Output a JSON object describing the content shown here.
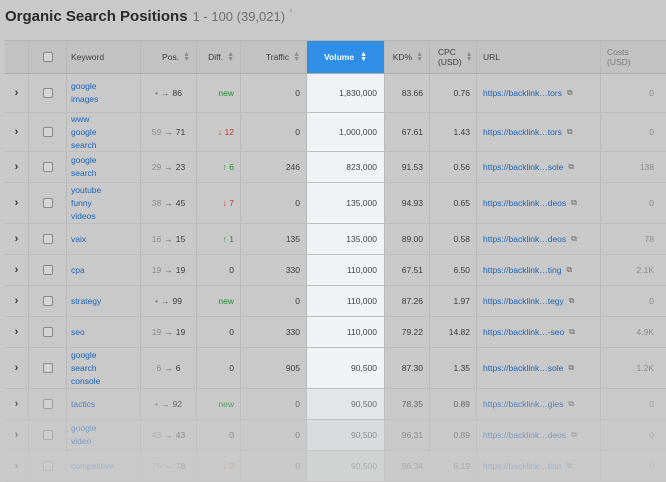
{
  "header": {
    "title": "Organic Search Positions",
    "range": "1 - 100 (39,021)",
    "info": "ⁱ"
  },
  "columns": {
    "keyword": "Keyword",
    "pos": "Pos.",
    "diff": "Diff.",
    "traffic": "Traffic",
    "volume": "Volume",
    "kd": "KD%",
    "cpc_1": "CPC",
    "cpc_2": "(USD)",
    "url": "URL",
    "costs_1": "Costs",
    "costs_2": "(USD)"
  },
  "rows": [
    {
      "keyword": "google images",
      "kw_lines": [
        "google",
        "images"
      ],
      "pos_from": "•",
      "pos_to": "86",
      "diff": "new",
      "diff_type": "new",
      "traffic": "0",
      "volume": "1,830,000",
      "kd": "83.66",
      "cpc": "0.76",
      "url": "https://backlink…tors",
      "costs": "0"
    },
    {
      "keyword": "www google search",
      "kw_lines": [
        "www",
        "google",
        "search"
      ],
      "pos_from": "59",
      "pos_to": "71",
      "diff": "↓ 12",
      "diff_type": "down",
      "traffic": "0",
      "volume": "1,000,000",
      "kd": "67.61",
      "cpc": "1.43",
      "url": "https://backlink…tors",
      "costs": "0"
    },
    {
      "keyword": "google search",
      "kw_lines": [
        "google",
        "search"
      ],
      "pos_from": "29",
      "pos_to": "23",
      "diff": "↑ 6",
      "diff_type": "up",
      "traffic": "246",
      "volume": "823,000",
      "kd": "91.53",
      "cpc": "0.56",
      "url": "https://backlink…sole",
      "costs": "138"
    },
    {
      "keyword": "youtube funny videos",
      "kw_lines": [
        "youtube",
        "funny",
        "videos"
      ],
      "pos_from": "38",
      "pos_to": "45",
      "diff": "↓ 7",
      "diff_type": "down",
      "traffic": "0",
      "volume": "135,000",
      "kd": "94.93",
      "cpc": "0.65",
      "url": "https://backlink…deos",
      "costs": "0"
    },
    {
      "keyword": "vaix",
      "kw_lines": [
        "vaix"
      ],
      "pos_from": "16",
      "pos_to": "15",
      "diff": "↑ 1",
      "diff_type": "up",
      "traffic": "135",
      "volume": "135,000",
      "kd": "89.00",
      "cpc": "0.58",
      "url": "https://backlink…deos",
      "costs": "78"
    },
    {
      "keyword": "cpa",
      "kw_lines": [
        "cpa"
      ],
      "pos_from": "19",
      "pos_to": "19",
      "diff": "0",
      "diff_type": "zero",
      "traffic": "330",
      "volume": "110,000",
      "kd": "67.51",
      "cpc": "6.50",
      "url": "https://backlink…ting",
      "costs": "2.1K"
    },
    {
      "keyword": "strategy",
      "kw_lines": [
        "strategy"
      ],
      "pos_from": "•",
      "pos_to": "99",
      "diff": "new",
      "diff_type": "new",
      "traffic": "0",
      "volume": "110,000",
      "kd": "87.26",
      "cpc": "1.97",
      "url": "https://backlink…tegy",
      "costs": "0"
    },
    {
      "keyword": "seo",
      "kw_lines": [
        "seo"
      ],
      "pos_from": "19",
      "pos_to": "19",
      "diff": "0",
      "diff_type": "zero",
      "traffic": "330",
      "volume": "110,000",
      "kd": "79.22",
      "cpc": "14.82",
      "url": "https://backlink…-seo",
      "costs": "4.9K"
    },
    {
      "keyword": "google search console",
      "kw_lines": [
        "google",
        "search",
        "console"
      ],
      "pos_from": "6",
      "pos_to": "6",
      "diff": "0",
      "diff_type": "zero",
      "traffic": "905",
      "volume": "90,500",
      "kd": "87.30",
      "cpc": "1.35",
      "url": "https://backlink…sole",
      "costs": "1.2K"
    },
    {
      "keyword": "tactics",
      "kw_lines": [
        "tactics"
      ],
      "pos_from": "•",
      "pos_to": "92",
      "diff": "new",
      "diff_type": "new",
      "traffic": "0",
      "volume": "90,500",
      "kd": "78.35",
      "cpc": "0.89",
      "url": "https://backlink…gies",
      "costs": "0"
    },
    {
      "keyword": "google video",
      "kw_lines": [
        "google",
        "video"
      ],
      "pos_from": "43",
      "pos_to": "43",
      "diff": "0",
      "diff_type": "zero",
      "traffic": "0",
      "volume": "90,500",
      "kd": "96.31",
      "cpc": "0.89",
      "url": "https://backlink…deos",
      "costs": "0"
    },
    {
      "keyword": "competitive",
      "kw_lines": [
        "competitive"
      ],
      "pos_from": "76",
      "pos_to": "78",
      "diff": "↓ 2",
      "diff_type": "down",
      "traffic": "0",
      "volume": "90,500",
      "kd": "86.34",
      "cpc": "6.19",
      "url": "https://backlink…tion",
      "costs": "0"
    }
  ],
  "colors": {
    "accent": "#2f8fe6",
    "link": "#1a64b8",
    "up": "#1b8f2e",
    "down": "#c0392b"
  }
}
